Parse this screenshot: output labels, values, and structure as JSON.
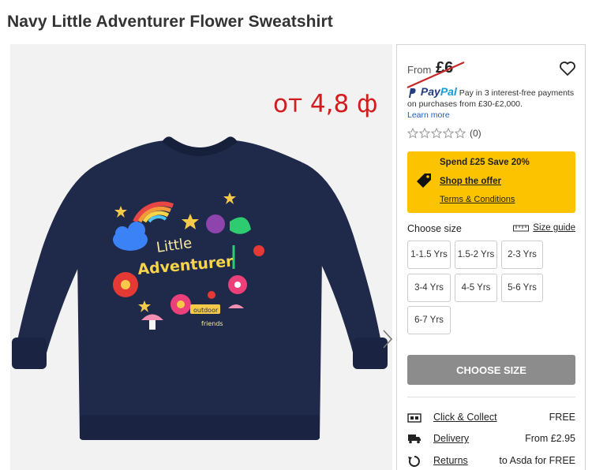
{
  "page": {
    "title": "Navy Little Adventurer Flower Sweatshirt"
  },
  "gallery": {
    "annotation": "от 4,8 ф",
    "artwork_text_1": "Little",
    "artwork_text_2": "Adventurer",
    "artwork_text_3": "outdoor",
    "artwork_text_4": "friends"
  },
  "price": {
    "from_label": "From",
    "value": "£6"
  },
  "paypal": {
    "brand_pay": "Pay",
    "brand_pal": "Pal",
    "text": "Pay in 3 interest-free payments on purchases from £30-£2,000.",
    "learn_more": "Learn more"
  },
  "rating": {
    "count": "(0)",
    "stars": 0
  },
  "promo": {
    "headline": "Spend £25 Save 20%",
    "shop_link": "Shop the offer",
    "terms_link": "Terms & Conditions"
  },
  "sizes": {
    "label": "Choose size",
    "guide": "Size guide",
    "options": [
      "1-1.5 Yrs",
      "1.5-2 Yrs",
      "2-3 Yrs",
      "3-4 Yrs",
      "4-5 Yrs",
      "5-6 Yrs",
      "6-7 Yrs"
    ]
  },
  "cta": {
    "choose_size": "CHOOSE SIZE"
  },
  "delivery": {
    "items": [
      {
        "label": "Click & Collect",
        "value": "FREE",
        "icon": "store-icon"
      },
      {
        "label": "Delivery",
        "value": "From £2.95",
        "icon": "truck-icon"
      },
      {
        "label": "Returns",
        "value": "to Asda for FREE",
        "icon": "returns-icon"
      }
    ]
  },
  "colors": {
    "promo_bg": "#fcc400",
    "cta_disabled": "#8c8c8c",
    "annotation": "#d11d1d",
    "sweatshirt_navy": "#1f2a4a"
  }
}
